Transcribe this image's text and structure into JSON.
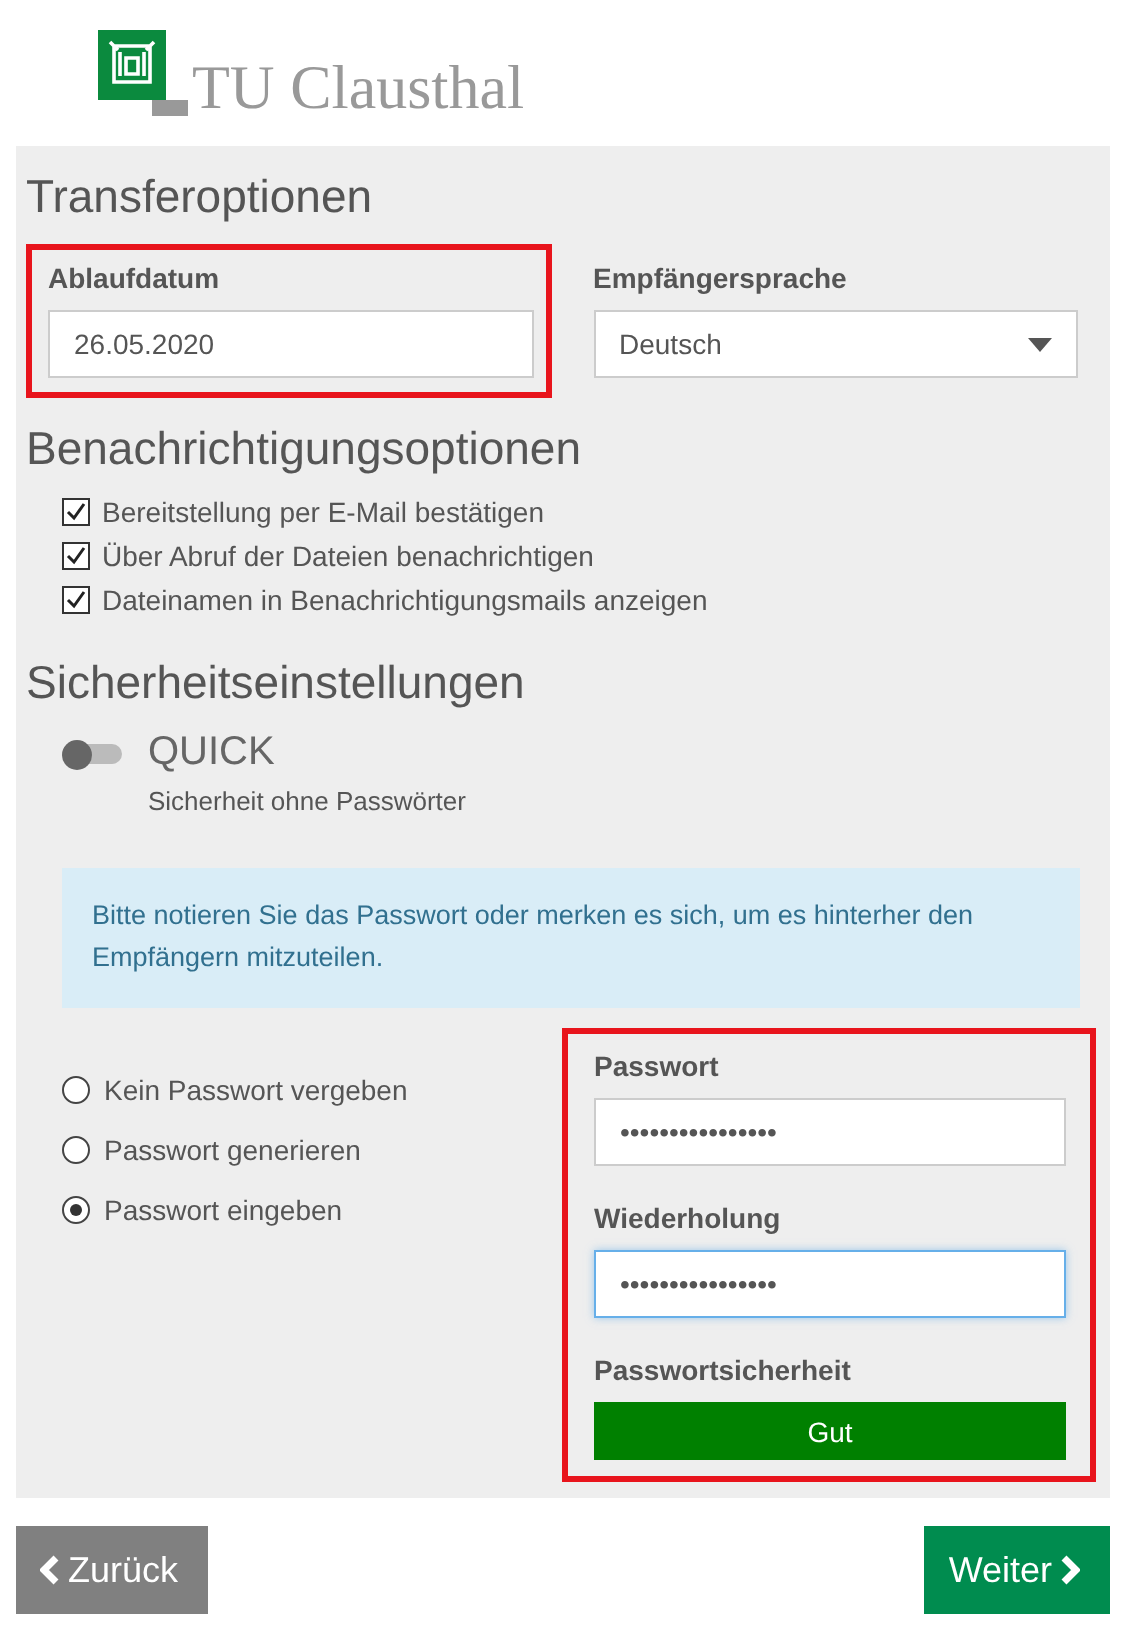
{
  "logo": {
    "text": "TU Clausthal"
  },
  "transfer": {
    "title": "Transferoptionen",
    "expiry": {
      "label": "Ablaufdatum",
      "value": "26.05.2020",
      "highlighted": true
    },
    "language": {
      "label": "Empfängersprache",
      "value": "Deutsch"
    }
  },
  "notifications": {
    "title": "Benachrichtigungsoptionen",
    "options": [
      {
        "label": "Bereitstellung per E-Mail bestätigen",
        "checked": true
      },
      {
        "label": "Über Abruf der Dateien benachrichtigen",
        "checked": true
      },
      {
        "label": "Dateinamen in Benachrichtigungsmails anzeigen",
        "checked": true
      }
    ]
  },
  "security": {
    "title": "Sicherheitseinstellungen",
    "quick": {
      "label": "QUICK",
      "description": "Sicherheit ohne Passwörter",
      "on": false
    },
    "notice": "Bitte notieren Sie das Passwort oder merken es sich, um es hinterher den Empfängern mitzuteilen.",
    "modes": [
      {
        "label": "Kein Passwort vergeben",
        "selected": false
      },
      {
        "label": "Passwort generieren",
        "selected": false
      },
      {
        "label": "Passwort eingeben",
        "selected": true
      }
    ],
    "password_panel": {
      "highlighted": true,
      "password": {
        "label": "Passwort",
        "value": "••••••••••••••••",
        "focused": false
      },
      "repeat": {
        "label": "Wiederholung",
        "value": "••••••••••••••••",
        "focused": true
      },
      "strength": {
        "label": "Passwortsicherheit",
        "reading": "Gut",
        "level": 1
      }
    }
  },
  "buttons": [
    {
      "kind": "back",
      "label": "Zurück"
    },
    {
      "kind": "next",
      "label": "Weiter"
    }
  ]
}
